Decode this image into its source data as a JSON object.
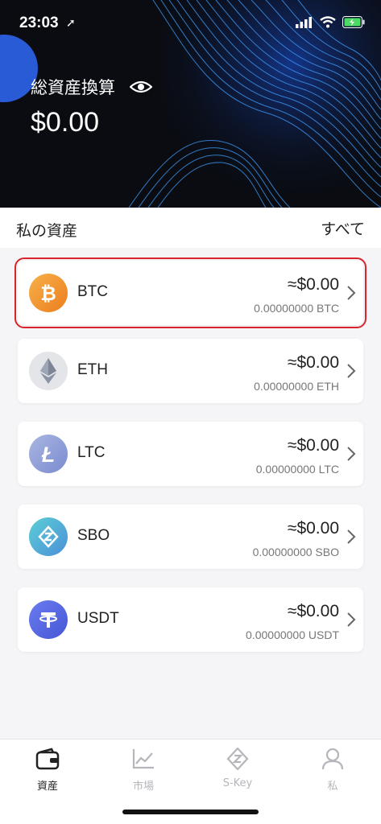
{
  "status": {
    "time": "23:03"
  },
  "header": {
    "total_label": "総資産換算",
    "total_value": "$0.00"
  },
  "section": {
    "title": "私の資産",
    "all_label": "すべて"
  },
  "assets": [
    {
      "symbol": "BTC",
      "usd": "≈$0.00",
      "amount": "0.00000000 BTC",
      "color": "#f0962b",
      "icon": "bitcoin-icon"
    },
    {
      "symbol": "ETH",
      "usd": "≈$0.00",
      "amount": "0.00000000 ETH",
      "color": "#e3e4e8",
      "icon": "ethereum-icon"
    },
    {
      "symbol": "LTC",
      "usd": "≈$0.00",
      "amount": "0.00000000 LTC",
      "color": "#8f9fd6",
      "icon": "litecoin-icon"
    },
    {
      "symbol": "SBO",
      "usd": "≈$0.00",
      "amount": "0.00000000 SBO",
      "color": "#4fb8c8",
      "icon": "sbo-icon"
    },
    {
      "symbol": "USDT",
      "usd": "≈$0.00",
      "amount": "0.00000000 USDT",
      "color": "#5d6fe8",
      "icon": "tether-icon"
    }
  ],
  "tabs": [
    {
      "label": "資産",
      "icon": "wallet-icon",
      "active": true
    },
    {
      "label": "市場",
      "icon": "chart-icon",
      "active": false
    },
    {
      "label": "S-Key",
      "icon": "skey-icon",
      "active": false
    },
    {
      "label": "私",
      "icon": "person-icon",
      "active": false
    }
  ],
  "colors": {
    "header_bg": "#0a0c12",
    "accent_blue": "#2a5bd7",
    "highlight": "#d9232d"
  }
}
